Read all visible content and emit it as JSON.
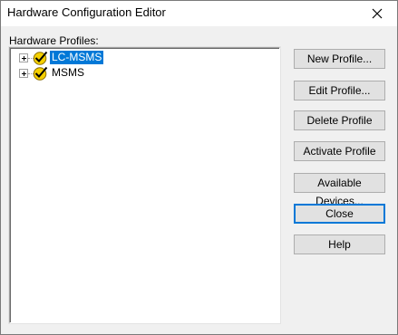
{
  "window": {
    "title": "Hardware Configuration Editor",
    "close_glyph": "✕"
  },
  "profiles": {
    "label": "Hardware Profiles:",
    "items": [
      {
        "label": "LC-MSMS",
        "selected": true,
        "icon": "active-check-icon"
      },
      {
        "label": "MSMS",
        "selected": false,
        "icon": "active-check-icon"
      }
    ]
  },
  "buttons": {
    "new_profile": "New Profile...",
    "edit_profile": "Edit Profile...",
    "delete_profile": "Delete Profile",
    "activate_profile": "Activate Profile",
    "available_devices": "Available Devices...",
    "close": "Close",
    "help": "Help"
  },
  "colors": {
    "selection": "#0078d7",
    "check_fill": "#f5d000",
    "check_mark": "#000000"
  }
}
